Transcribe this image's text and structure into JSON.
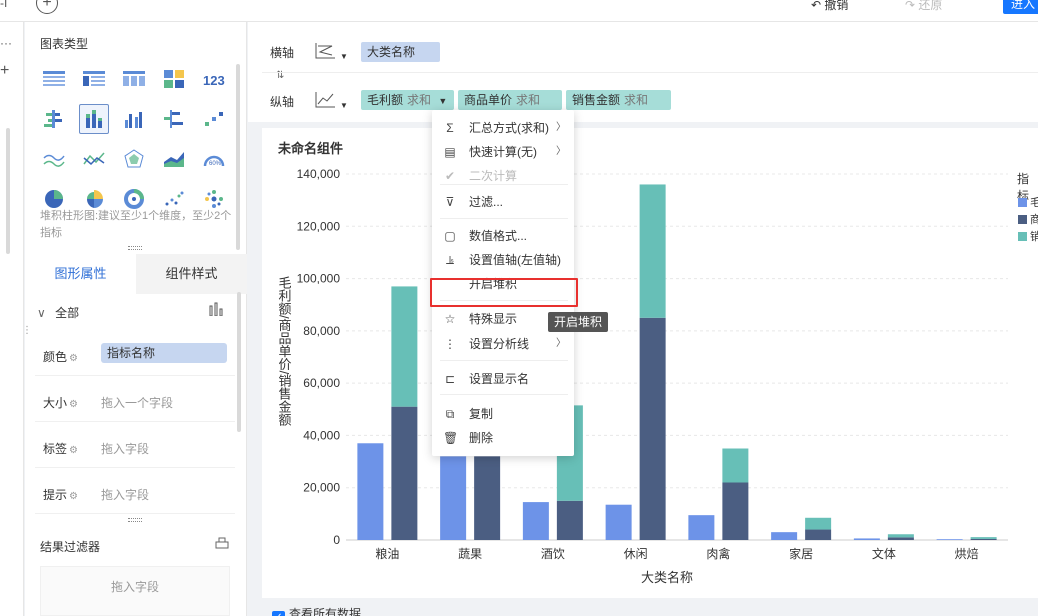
{
  "topbar": {
    "undo_label": "撤销",
    "redo_label": "还原",
    "primary_button_label": "进入"
  },
  "panel": {
    "chart_type_title": "图表类型",
    "chart_type_hint": "堆积柱形图:建议至少1个维度，至少2个指标",
    "tabs": [
      "图形属性",
      "组件样式"
    ],
    "all_label": "全部",
    "properties": [
      {
        "label": "颜色",
        "value": "指标名称",
        "is_chip": true
      },
      {
        "label": "大小",
        "value": "拖入一个字段",
        "is_chip": false
      },
      {
        "label": "标签",
        "value": "拖入字段",
        "is_chip": false
      },
      {
        "label": "提示",
        "value": "拖入字段",
        "is_chip": false
      }
    ],
    "filter_title": "结果过滤器",
    "filter_drop_text": "拖入字段"
  },
  "axes": {
    "x_label": "横轴",
    "y_label": "纵轴",
    "x_fields": [
      {
        "name": "大类名称"
      }
    ],
    "y_fields": [
      {
        "name": "毛利额",
        "agg": "求和",
        "has_dropdown": true
      },
      {
        "name": "商品单价",
        "agg": "求和"
      },
      {
        "name": "销售金额",
        "agg": "求和"
      }
    ]
  },
  "card": {
    "title": "未命名组件",
    "legend_title": "指标",
    "show_all_label": "查看所有数据"
  },
  "chart_data": {
    "type": "bar",
    "title": "未命名组件",
    "xlabel": "大类名称",
    "ylabel": "毛利额/商品单价/销售金额",
    "categories": [
      "粮油",
      "蔬果",
      "酒饮",
      "休闲",
      "肉禽",
      "家居",
      "文体",
      "烘焙"
    ],
    "ylim": [
      0,
      140000
    ],
    "yticks": [
      0,
      20000,
      40000,
      60000,
      80000,
      100000,
      120000,
      140000
    ],
    "ytick_labels": [
      "0",
      "20,000",
      "40,000",
      "60,000",
      "80,000",
      "100,000",
      "120,000",
      "140,000"
    ],
    "grid": true,
    "legend_position": "right",
    "series": [
      {
        "name": "毛利额",
        "color": "#6d93e8",
        "values": [
          37000,
          32000,
          14500,
          13500,
          9500,
          3000,
          600,
          300
        ]
      },
      {
        "name": "商品单价",
        "color": "#4b5e82",
        "values": [
          51000,
          32000,
          15000,
          85000,
          22000,
          4000,
          1000,
          400
        ]
      },
      {
        "name": "销售金额",
        "color": "#67bfb7",
        "values": [
          46000,
          0,
          36500,
          51000,
          13000,
          4500,
          1200,
          700
        ]
      }
    ],
    "legend_labels": [
      "毛",
      "商",
      "销"
    ]
  },
  "context_menu": {
    "items": [
      {
        "icon": "sum-icon",
        "glyph": "Σ",
        "label": "汇总方式(求和)",
        "submenu": true,
        "disabled": false
      },
      {
        "icon": "quick-calc-icon",
        "glyph": "▤",
        "label": "快速计算(无)",
        "submenu": true,
        "disabled": false
      },
      {
        "icon": "check-icon",
        "glyph": "✔",
        "label": "二次计算",
        "submenu": false,
        "disabled": true
      },
      {
        "icon": "filter-icon",
        "glyph": "⊽",
        "label": "过滤...",
        "submenu": false,
        "disabled": false
      },
      {
        "icon": "number-format-icon",
        "glyph": "▢",
        "label": "数值格式...",
        "submenu": false,
        "disabled": false
      },
      {
        "icon": "value-axis-icon",
        "glyph": "⫡",
        "label": "设置值轴(左值轴)",
        "submenu": false,
        "disabled": false
      },
      {
        "icon": "",
        "glyph": "",
        "label": "开启堆积",
        "submenu": false,
        "disabled": false
      },
      {
        "icon": "star-icon",
        "glyph": "☆",
        "label": "特殊显示",
        "submenu": false,
        "disabled": false
      },
      {
        "icon": "analysis-line-icon",
        "glyph": "⋮",
        "label": "设置分析线",
        "submenu": true,
        "disabled": false
      },
      {
        "icon": "display-name-icon",
        "glyph": "⊏",
        "label": "设置显示名",
        "submenu": false,
        "disabled": false
      },
      {
        "icon": "copy-icon",
        "glyph": "⧉",
        "label": "复制",
        "submenu": false,
        "disabled": false
      },
      {
        "icon": "trash-icon",
        "glyph": "🗑",
        "label": "删除",
        "submenu": false,
        "disabled": false
      }
    ],
    "tooltip": "开启堆积"
  }
}
